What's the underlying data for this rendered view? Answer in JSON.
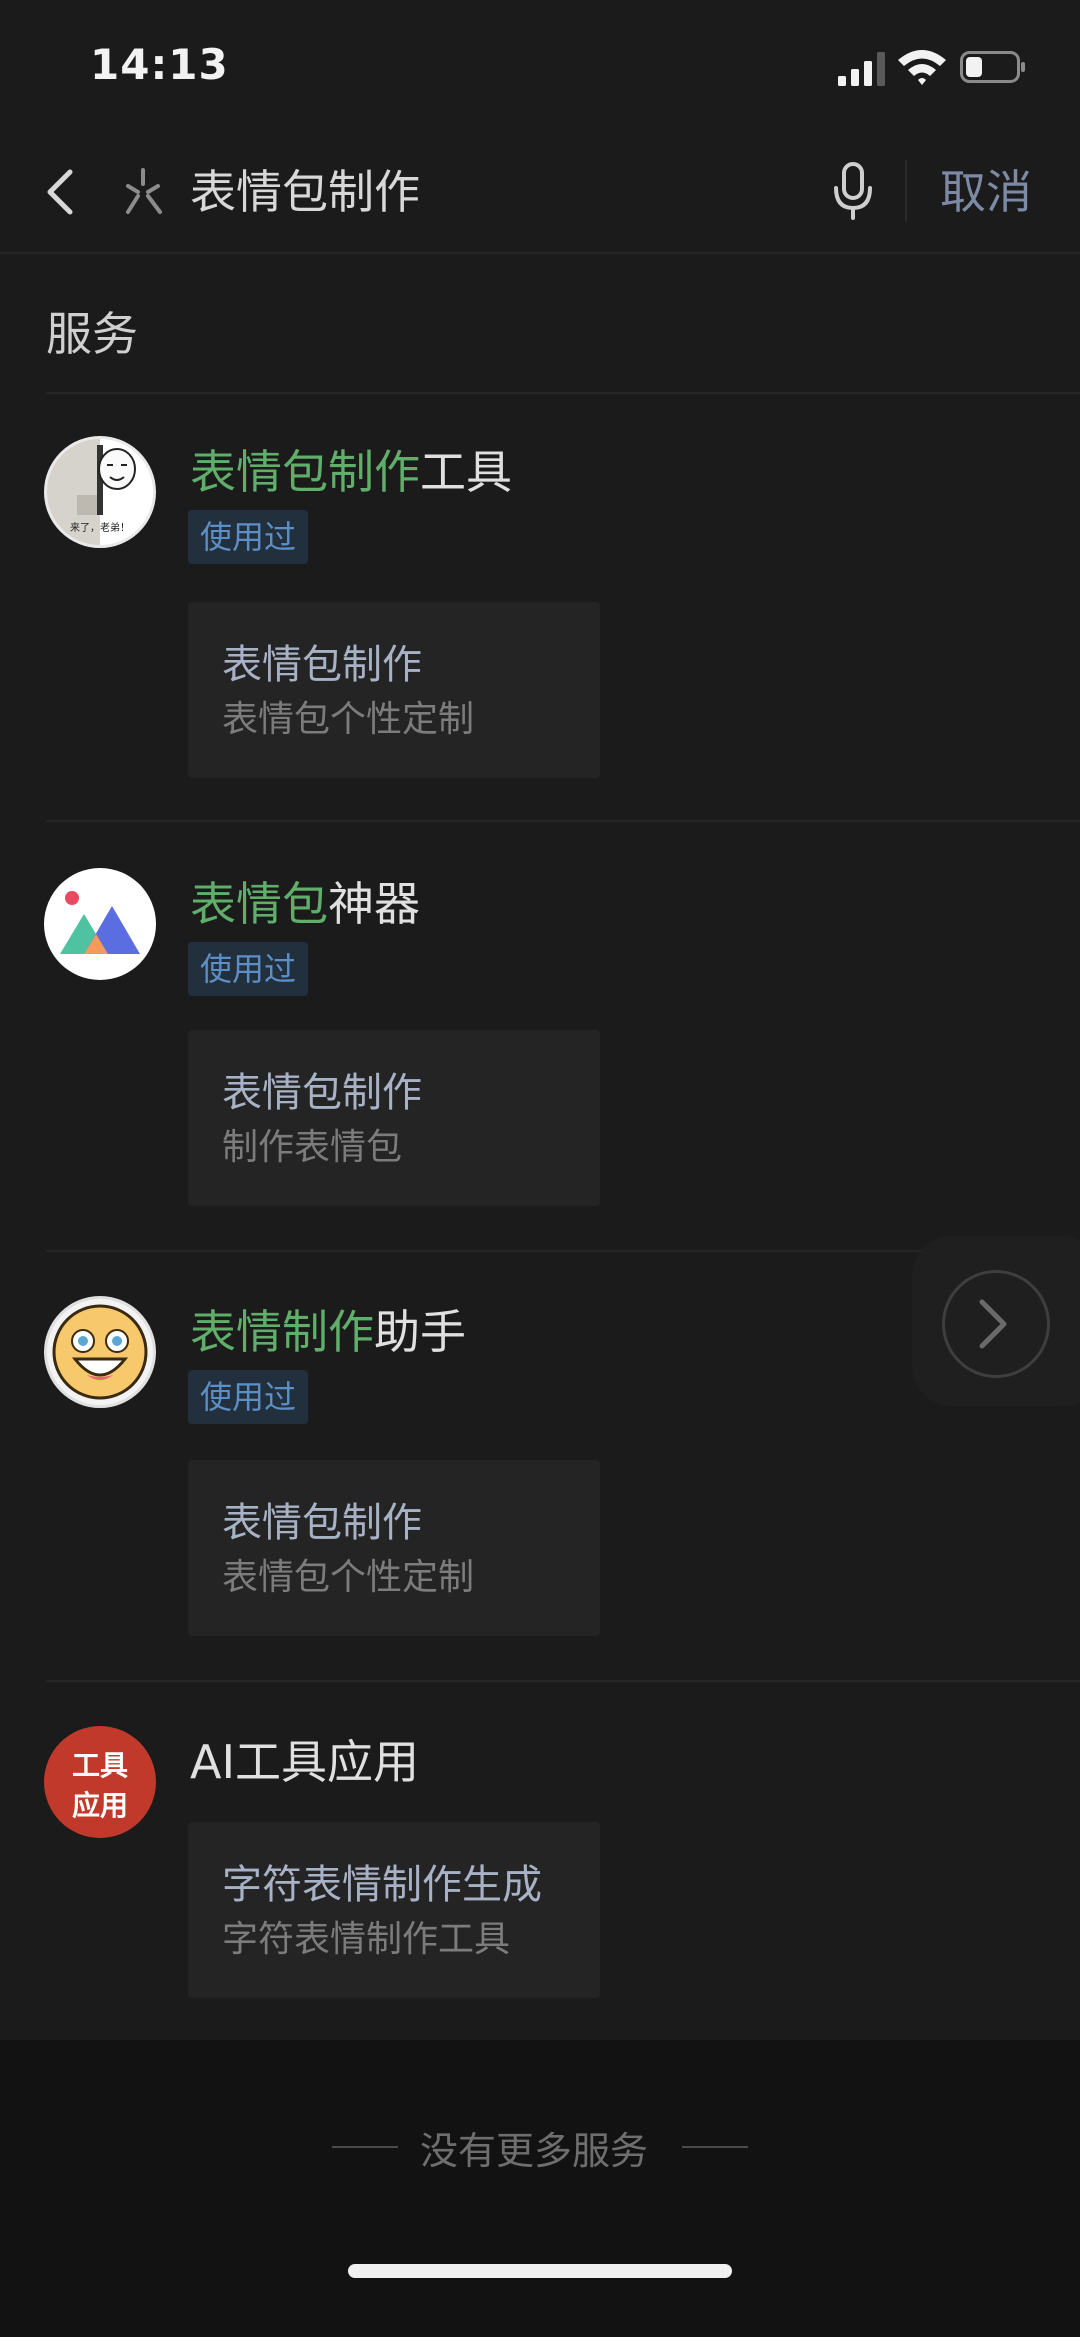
{
  "status_bar": {
    "time": "14:13"
  },
  "search": {
    "query": "表情包制作",
    "cancel_label": "取消"
  },
  "section": {
    "title": "服务"
  },
  "items": [
    {
      "title_highlight": "表情包制作",
      "title_rest": "工具",
      "badge": "使用过",
      "card_title": "表情包制作",
      "card_subtitle": "表情包个性定制",
      "avatar_caption": "来了，老弟！",
      "avatar_icon": "meme-face-avatar"
    },
    {
      "title_highlight": "表情包",
      "title_rest": "神器",
      "badge": "使用过",
      "card_title": "表情包制作",
      "card_subtitle": "制作表情包",
      "avatar_icon": "mountains-avatar"
    },
    {
      "title_highlight": "表情制作",
      "title_rest": "助手",
      "badge": "使用过",
      "card_title": "表情包制作",
      "card_subtitle": "表情包个性定制",
      "avatar_icon": "smiley-avatar"
    },
    {
      "title_highlight": "",
      "title_rest": "AI工具应用",
      "card_title": "字符表情制作生成",
      "card_subtitle": "字符表情制作工具",
      "avatar_line1": "工具",
      "avatar_line2": "应用",
      "avatar_icon": "tool-app-avatar"
    }
  ],
  "footer": {
    "text": "没有更多服务"
  },
  "colors": {
    "highlight": "#5fae6a",
    "link": "#7d8aa6",
    "badge_text": "#5c8fc6",
    "background": "#1b1b1b"
  }
}
